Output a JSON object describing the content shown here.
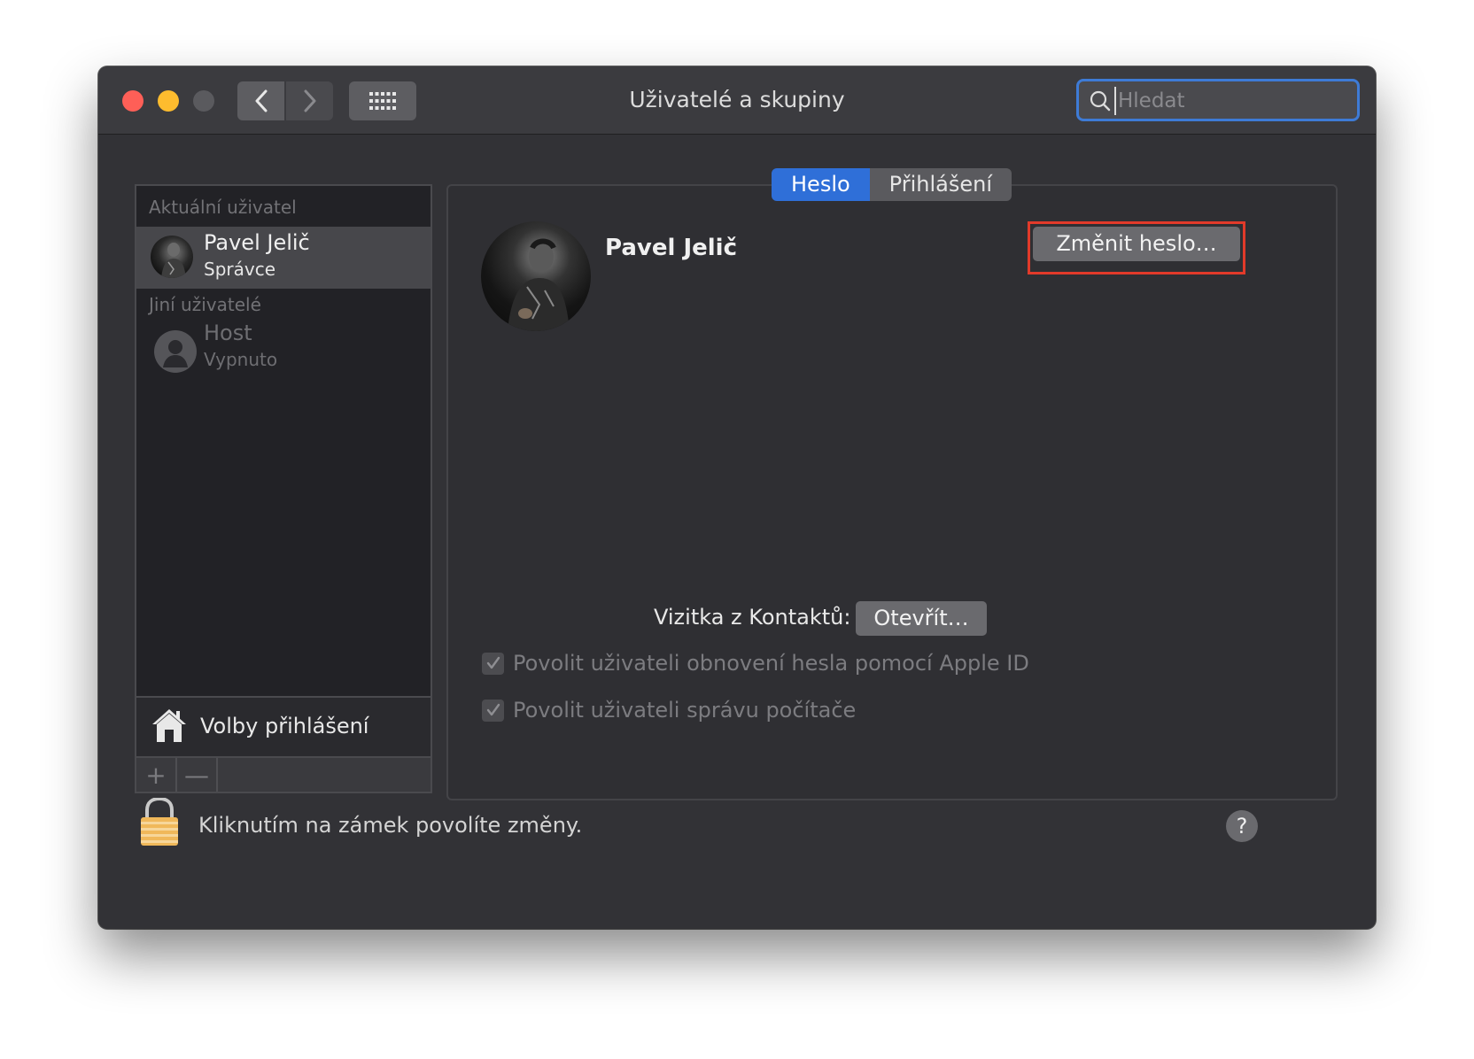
{
  "window": {
    "title": "Uživatelé a skupiny"
  },
  "search": {
    "placeholder": "Hledat",
    "value": ""
  },
  "sidebar": {
    "current_section": "Aktuální uživatel",
    "current_user": {
      "name": "Pavel Jelič",
      "role": "Správce"
    },
    "other_section": "Jiní uživatelé",
    "other_users": [
      {
        "name": "Host",
        "status": "Vypnuto"
      }
    ],
    "login_options_label": "Volby přihlášení",
    "toolbar": {
      "add": "+",
      "remove": "—"
    }
  },
  "tabs": [
    {
      "label": "Heslo",
      "active": true
    },
    {
      "label": "Přihlášení",
      "active": false
    }
  ],
  "profile": {
    "name": "Pavel Jelič",
    "change_password_button": "Změnit heslo…"
  },
  "contact": {
    "label": "Vizitka z Kontaktů:",
    "open_button": "Otevřít…"
  },
  "checkboxes": [
    {
      "label": "Povolit uživateli obnovení hesla pomocí Apple ID",
      "checked": true
    },
    {
      "label": "Povolit uživateli správu počítače",
      "checked": true
    }
  ],
  "footer": {
    "lock_text": "Kliknutím na zámek povolíte změny.",
    "help": "?"
  },
  "colors": {
    "accent": "#2f6fd8",
    "highlight": "#e23a2a",
    "window_bg": "#323236"
  }
}
